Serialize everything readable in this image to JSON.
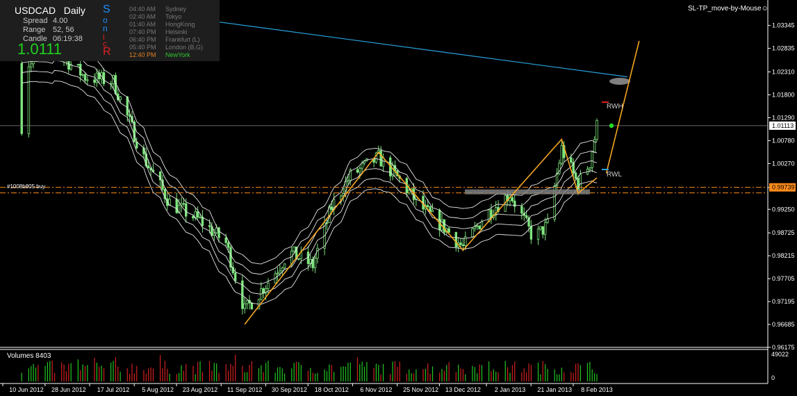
{
  "info": {
    "symbol": "USDCAD",
    "timeframe": "Daily",
    "spread_label": "Spread",
    "spread_value": "4.00",
    "range_label": "Range",
    "range_value": "52, 56",
    "candle_label": "Candle",
    "candle_value": "06:19:38",
    "bid": "1.0111",
    "sonic_letters": [
      "S",
      "o",
      "n",
      "i",
      "c",
      "R"
    ],
    "sessions": [
      {
        "time": "04:40 AM",
        "city": "Sydney"
      },
      {
        "time": "02:40 AM",
        "city": "Tokyo"
      },
      {
        "time": "01:40 AM",
        "city": "HongKong"
      },
      {
        "time": "07:40 PM",
        "city": "Helsinki"
      },
      {
        "time": "06:40 PM",
        "city": "Frankfurt  (L)"
      },
      {
        "time": "05:40 PM",
        "city": "London  (B,G)"
      },
      {
        "time": "12:40 PM",
        "city": "NewYork"
      }
    ]
  },
  "ea_label": "SL-TP_move-by-Mouse",
  "chart_data": {
    "type": "candlestick",
    "price_axis": {
      "ticks": [
        "1.03345",
        "1.02835",
        "1.02310",
        "1.01800",
        "1.01290",
        "1.00780",
        "1.00270",
        "0.99735",
        "0.99250",
        "0.98725",
        "0.98215",
        "0.97705",
        "0.97195",
        "0.96685",
        "0.96175"
      ],
      "range": [
        0.96175,
        1.0385
      ]
    },
    "current_price": "1.01113",
    "order_price": "0.99739",
    "order_label": "#1008b805 buy",
    "date_ticks": [
      "10 Jun 2012",
      "28 Jun 2012",
      "17 Jul 2012",
      "5 Aug 2012",
      "23 Aug 2012",
      "11 Sep 2012",
      "30 Sep 2012",
      "18 Oct 2012",
      "6 Nov 2012",
      "25 Nov 2012",
      "13 Dec 2012",
      "2 Jan 2013",
      "21 Jan 2013",
      "8 Feb 2013"
    ],
    "zigzag": [
      {
        "date": "11 Sep 2012",
        "price": 0.9669
      },
      {
        "date": "7 Nov 2012",
        "price": 1.0052
      },
      {
        "date": "13 Dec 2012",
        "price": 0.9834
      },
      {
        "date": "24 Jan 2013",
        "price": 1.0081
      },
      {
        "date": "31 Jan 2013",
        "price": 0.9961
      },
      {
        "date": "8 Feb 2013",
        "price": 0.9995
      }
    ],
    "trend_line": [
      {
        "date": "24 Jun 2012",
        "price": 1.039
      },
      {
        "date": "21 Feb 2013",
        "price": 1.022
      }
    ],
    "orange_line": [
      {
        "date": "12 Feb 2013",
        "price": 1.0005
      },
      {
        "date": "26 Feb 2013",
        "price": 1.03
      }
    ],
    "labels": {
      "rwh": "RWH",
      "rwl": "RWL"
    },
    "volumes": {
      "label": "Volumes 8403",
      "max": "49022",
      "zero": "0"
    }
  }
}
